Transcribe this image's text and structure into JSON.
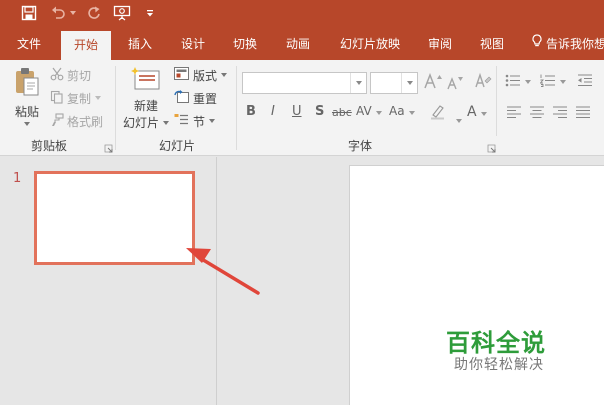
{
  "quick_access": {
    "save_icon": "save-icon",
    "undo_icon": "undo-icon",
    "redo_icon": "redo-icon",
    "present_icon": "present-from-start-icon",
    "customize_icon": "customize-qat-icon"
  },
  "tabs": [
    {
      "label": "文件",
      "active": false
    },
    {
      "label": "开始",
      "active": true
    },
    {
      "label": "插入",
      "active": false
    },
    {
      "label": "设计",
      "active": false
    },
    {
      "label": "切换",
      "active": false
    },
    {
      "label": "动画",
      "active": false
    },
    {
      "label": "幻灯片放映",
      "active": false
    },
    {
      "label": "审阅",
      "active": false
    },
    {
      "label": "视图",
      "active": false
    }
  ],
  "tell_me": {
    "label": "告诉我你想",
    "icon": "lightbulb-icon"
  },
  "ribbon": {
    "clipboard": {
      "group_label": "剪贴板",
      "paste": "粘贴",
      "cut": "剪切",
      "copy": "复制",
      "format_painter": "格式刷"
    },
    "slides": {
      "group_label": "幻灯片",
      "new_slide_line1": "新建",
      "new_slide_line2": "幻灯片",
      "layout": "版式",
      "reset": "重置",
      "section": "节"
    },
    "font": {
      "group_label": "字体",
      "font_name_value": "",
      "font_size_value": "",
      "bold": "B",
      "italic": "I",
      "underline": "U",
      "shadow": "S",
      "strikethrough": "abc",
      "char_spacing": "AV",
      "change_case": "Aa",
      "font_color": "A"
    }
  },
  "thumbnails": {
    "slide_number": "1"
  },
  "watermark": {
    "title": "百科全说",
    "subtitle": "助你轻松解决"
  },
  "colors": {
    "accent": "#b7472a",
    "selection_border": "#e2725b",
    "watermark_green": "#2e9c3a"
  }
}
